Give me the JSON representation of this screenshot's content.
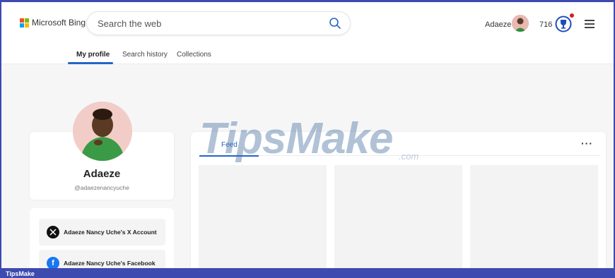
{
  "brand": {
    "name": "Microsoft Bing",
    "logo_colors": [
      "#f25022",
      "#7fba00",
      "#00a4ef",
      "#ffb900"
    ]
  },
  "search": {
    "placeholder": "Search the web",
    "value": ""
  },
  "header": {
    "user_name": "Adaeze",
    "points": "716",
    "icons": [
      "search-icon",
      "rewards-icon",
      "hamburger-menu-icon"
    ]
  },
  "tabs": [
    {
      "label": "My profile",
      "active": true
    },
    {
      "label": "Search history",
      "active": false
    },
    {
      "label": "Collections",
      "active": false
    }
  ],
  "profile": {
    "name": "Adaeze",
    "handle": "@adaezenancyuche",
    "links": [
      {
        "label": "Adaeze Nancy Uche's X Account",
        "icon": "x-logo-icon"
      },
      {
        "label": "Adaeze Nancy Uche's Facebook",
        "icon": "facebook-icon"
      }
    ]
  },
  "feed": {
    "tab_label": "Feed",
    "more_label": "···"
  },
  "watermark": {
    "main": "TipsMake",
    "suffix": ".com"
  },
  "footer": {
    "label": "TipsMake"
  },
  "colors": {
    "accent": "#2563c7",
    "frame": "#3d4ab0",
    "notification": "#d41f1f"
  }
}
